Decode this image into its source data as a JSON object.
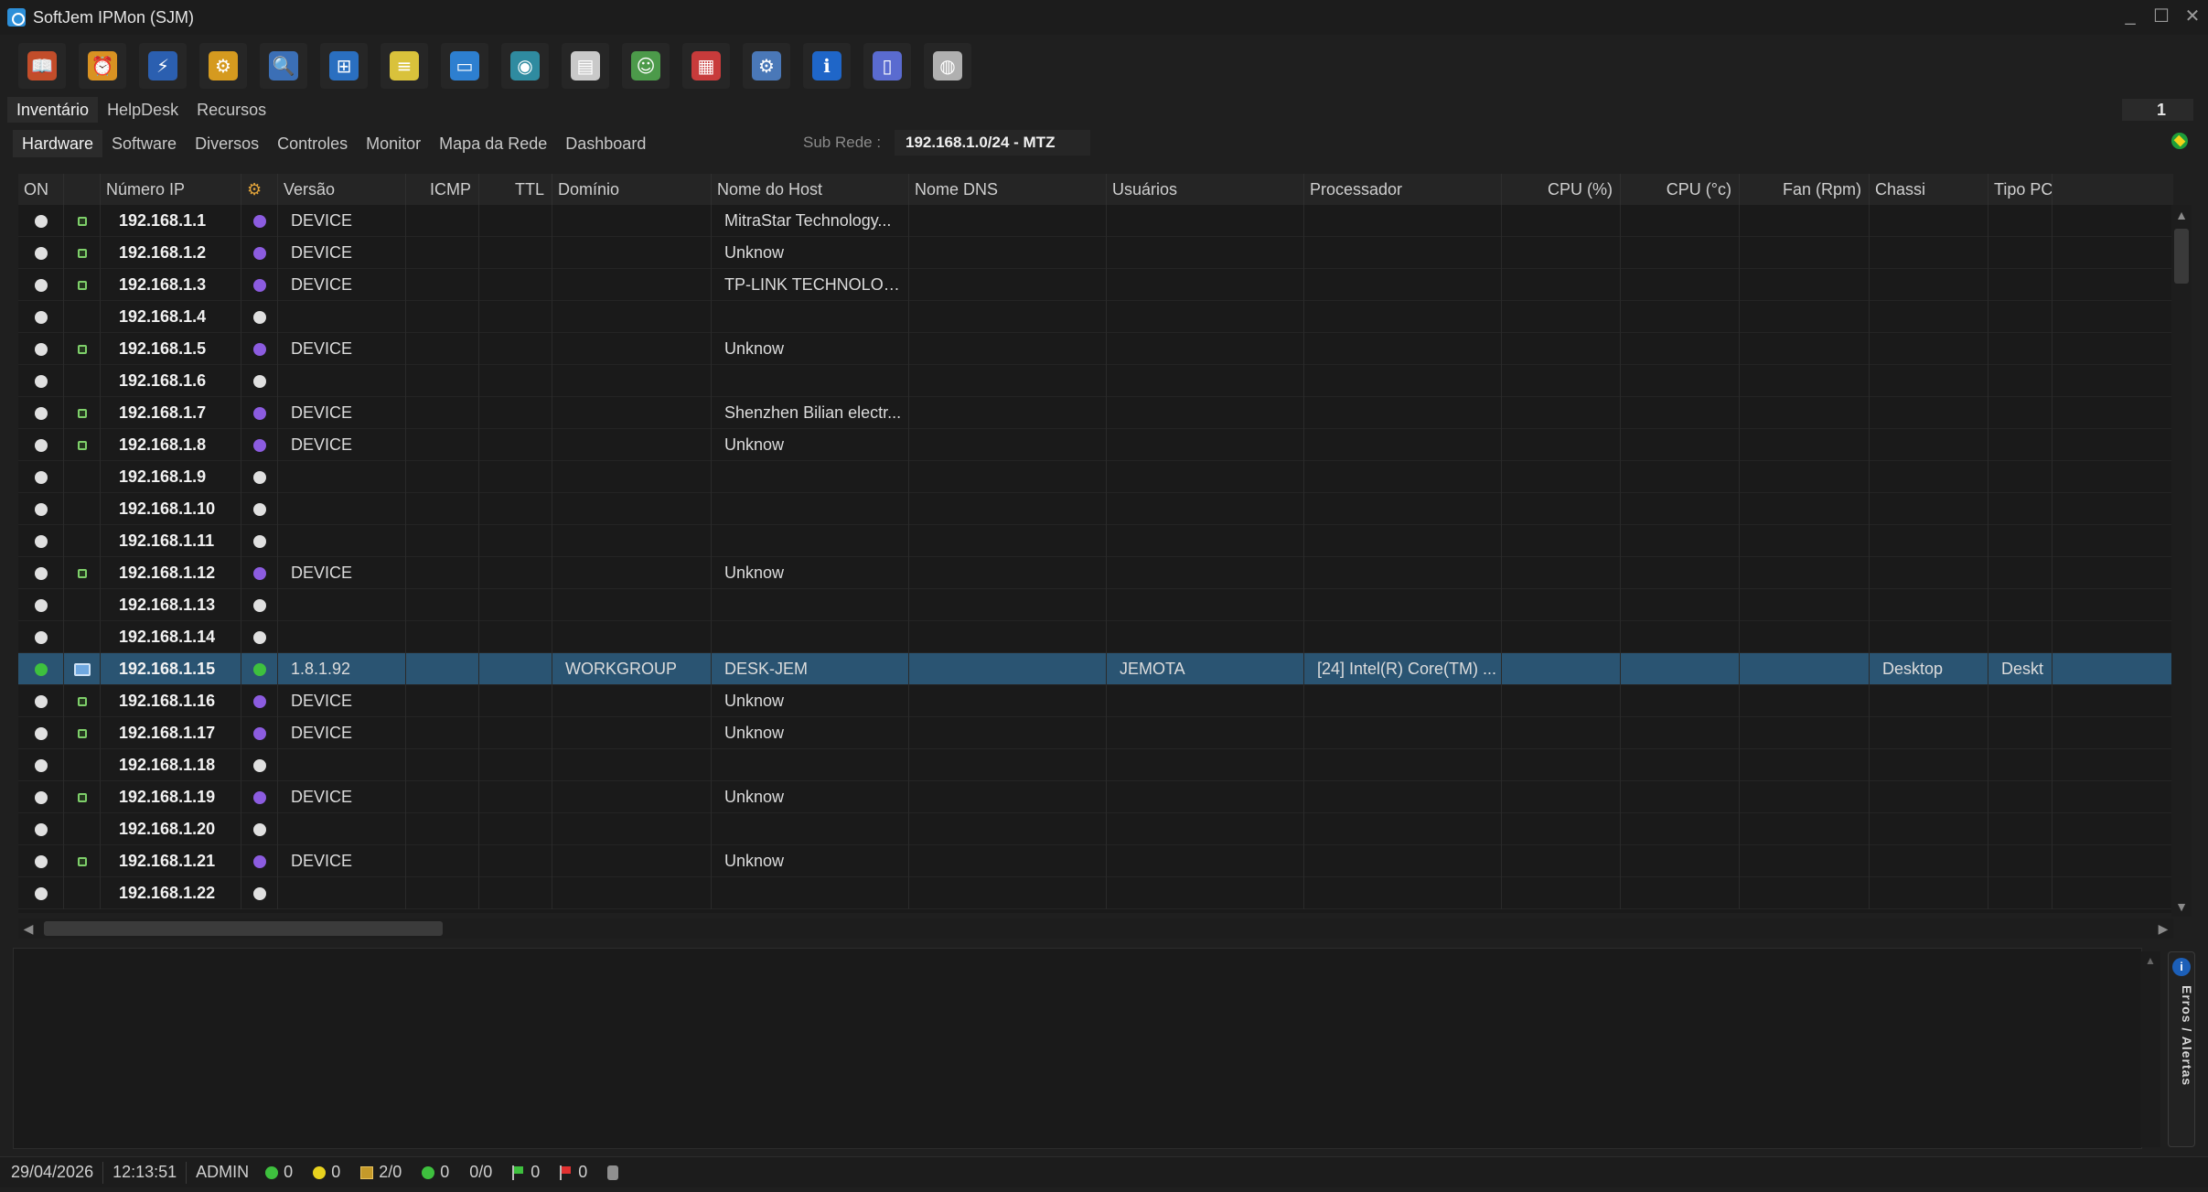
{
  "window": {
    "title": "SoftJem IPMon (SJM)",
    "controls": [
      "_",
      "☐",
      "✕"
    ]
  },
  "toolbar": {
    "buttons": [
      {
        "name": "open-book-icon",
        "color": "#c24d2a",
        "glyph": "📖"
      },
      {
        "name": "calendar-clock-icon",
        "color": "#d99222",
        "glyph": "⏰"
      },
      {
        "name": "lightning-icon",
        "color": "#2b5fb0",
        "glyph": "⚡"
      },
      {
        "name": "gears-icon",
        "color": "#d59a1f",
        "glyph": "⚙"
      },
      {
        "name": "magnifier-icon",
        "color": "#3b6fb6",
        "glyph": "🔍"
      },
      {
        "name": "network-add-icon",
        "color": "#2a6fc0",
        "glyph": "⊞"
      },
      {
        "name": "document-icon",
        "color": "#d9c23b",
        "glyph": "≡"
      },
      {
        "name": "monitor-icon",
        "color": "#2d7fd0",
        "glyph": "▭"
      },
      {
        "name": "camera-icon",
        "color": "#2f8ba0",
        "glyph": "◉"
      },
      {
        "name": "clipboard-icon",
        "color": "#c9c9c9",
        "glyph": "▤"
      },
      {
        "name": "users-icon",
        "color": "#4c9a4a",
        "glyph": "☺"
      },
      {
        "name": "chart-tools-icon",
        "color": "#c83b3b",
        "glyph": "▦"
      },
      {
        "name": "settings-icon",
        "color": "#4a78b8",
        "glyph": "⚙"
      },
      {
        "name": "info-icon",
        "color": "#1f66c8",
        "glyph": "ℹ"
      },
      {
        "name": "door-exit-icon",
        "color": "#5a6bd0",
        "glyph": "▯"
      },
      {
        "name": "palette-icon",
        "color": "#b0b0b0",
        "glyph": "◍"
      }
    ]
  },
  "top_tabs": [
    "Inventário",
    "HelpDesk",
    "Recursos"
  ],
  "page_number": "1",
  "sub_tabs": [
    "Hardware",
    "Software",
    "Diversos",
    "Controles",
    "Monitor",
    "Mapa da Rede",
    "Dashboard"
  ],
  "subnet": {
    "label": "Sub Rede :",
    "value": "192.168.1.0/24 - MTZ"
  },
  "columns": [
    "ON",
    "",
    "Número IP",
    "",
    "Versão",
    "ICMP",
    "TTL",
    "Domínio",
    "Nome do Host",
    "Nome DNS",
    "Usuários",
    "Processador",
    "CPU (%)",
    "CPU (°c)",
    "Fan (Rpm)",
    "Chassi",
    "Tipo PC"
  ],
  "rows": [
    {
      "type": "device",
      "ip": "192.168.1.1",
      "status": "purple",
      "versao": "DEVICE",
      "dominio": "",
      "host": "MitraStar Technology...",
      "usuarios": "",
      "processador": "",
      "chassi": "",
      "tipo": ""
    },
    {
      "type": "device",
      "ip": "192.168.1.2",
      "status": "purple",
      "versao": "DEVICE",
      "dominio": "",
      "host": "Unknow",
      "usuarios": "",
      "processador": "",
      "chassi": "",
      "tipo": ""
    },
    {
      "type": "device",
      "ip": "192.168.1.3",
      "status": "purple",
      "versao": "DEVICE",
      "dominio": "",
      "host": "TP-LINK TECHNOLOG...",
      "usuarios": "",
      "processador": "",
      "chassi": "",
      "tipo": ""
    },
    {
      "type": "none",
      "ip": "192.168.1.4",
      "status": "white",
      "versao": "",
      "dominio": "",
      "host": "",
      "usuarios": "",
      "processador": "",
      "chassi": "",
      "tipo": ""
    },
    {
      "type": "device",
      "ip": "192.168.1.5",
      "status": "purple",
      "versao": "DEVICE",
      "dominio": "",
      "host": "Unknow",
      "usuarios": "",
      "processador": "",
      "chassi": "",
      "tipo": ""
    },
    {
      "type": "none",
      "ip": "192.168.1.6",
      "status": "white",
      "versao": "",
      "dominio": "",
      "host": "",
      "usuarios": "",
      "processador": "",
      "chassi": "",
      "tipo": ""
    },
    {
      "type": "device",
      "ip": "192.168.1.7",
      "status": "purple",
      "versao": "DEVICE",
      "dominio": "",
      "host": "Shenzhen Bilian electr...",
      "usuarios": "",
      "processador": "",
      "chassi": "",
      "tipo": ""
    },
    {
      "type": "device",
      "ip": "192.168.1.8",
      "status": "purple",
      "versao": "DEVICE",
      "dominio": "",
      "host": "Unknow",
      "usuarios": "",
      "processador": "",
      "chassi": "",
      "tipo": ""
    },
    {
      "type": "none",
      "ip": "192.168.1.9",
      "status": "white",
      "versao": "",
      "dominio": "",
      "host": "",
      "usuarios": "",
      "processador": "",
      "chassi": "",
      "tipo": ""
    },
    {
      "type": "none",
      "ip": "192.168.1.10",
      "status": "white",
      "versao": "",
      "dominio": "",
      "host": "",
      "usuarios": "",
      "processador": "",
      "chassi": "",
      "tipo": ""
    },
    {
      "type": "none",
      "ip": "192.168.1.11",
      "status": "white",
      "versao": "",
      "dominio": "",
      "host": "",
      "usuarios": "",
      "processador": "",
      "chassi": "",
      "tipo": ""
    },
    {
      "type": "device",
      "ip": "192.168.1.12",
      "status": "purple",
      "versao": "DEVICE",
      "dominio": "",
      "host": "Unknow",
      "usuarios": "",
      "processador": "",
      "chassi": "",
      "tipo": ""
    },
    {
      "type": "none",
      "ip": "192.168.1.13",
      "status": "white",
      "versao": "",
      "dominio": "",
      "host": "",
      "usuarios": "",
      "processador": "",
      "chassi": "",
      "tipo": ""
    },
    {
      "type": "none",
      "ip": "192.168.1.14",
      "status": "white",
      "versao": "",
      "dominio": "",
      "host": "",
      "usuarios": "",
      "processador": "",
      "chassi": "",
      "tipo": ""
    },
    {
      "type": "pc",
      "ip": "192.168.1.15",
      "status": "green",
      "versao": "1.8.1.92",
      "dominio": "WORKGROUP",
      "host": "DESK-JEM",
      "usuarios": "JEMOTA",
      "processador": "[24] Intel(R) Core(TM) ...",
      "chassi": "Desktop",
      "tipo": "Deskt",
      "selected": true
    },
    {
      "type": "device",
      "ip": "192.168.1.16",
      "status": "purple",
      "versao": "DEVICE",
      "dominio": "",
      "host": "Unknow",
      "usuarios": "",
      "processador": "",
      "chassi": "",
      "tipo": ""
    },
    {
      "type": "device",
      "ip": "192.168.1.17",
      "status": "purple",
      "versao": "DEVICE",
      "dominio": "",
      "host": "Unknow",
      "usuarios": "",
      "processador": "",
      "chassi": "",
      "tipo": ""
    },
    {
      "type": "none",
      "ip": "192.168.1.18",
      "status": "white",
      "versao": "",
      "dominio": "",
      "host": "",
      "usuarios": "",
      "processador": "",
      "chassi": "",
      "tipo": ""
    },
    {
      "type": "device",
      "ip": "192.168.1.19",
      "status": "purple",
      "versao": "DEVICE",
      "dominio": "",
      "host": "Unknow",
      "usuarios": "",
      "processador": "",
      "chassi": "",
      "tipo": ""
    },
    {
      "type": "none",
      "ip": "192.168.1.20",
      "status": "white",
      "versao": "",
      "dominio": "",
      "host": "",
      "usuarios": "",
      "processador": "",
      "chassi": "",
      "tipo": ""
    },
    {
      "type": "device",
      "ip": "192.168.1.21",
      "status": "purple",
      "versao": "DEVICE",
      "dominio": "",
      "host": "Unknow",
      "usuarios": "",
      "processador": "",
      "chassi": "",
      "tipo": ""
    },
    {
      "type": "none",
      "ip": "192.168.1.22",
      "status": "white",
      "versao": "",
      "dominio": "",
      "host": "",
      "usuarios": "",
      "processador": "",
      "chassi": "",
      "tipo": ""
    }
  ],
  "side_panel": {
    "label": "Erros / Alertas"
  },
  "status_bar": {
    "date": "29/04/2026",
    "time": "12:13:51",
    "user": "ADMIN",
    "green_count": "0",
    "yellow_count": "0",
    "inventory": "2/0",
    "green_count_2": "0",
    "ratio": "0/0",
    "green_flag_count": "0",
    "red_flag_count": "0"
  },
  "colors": {
    "background": "#1f1f1f",
    "selected_row": "#2a5472",
    "online_green": "#3ec03e",
    "device_purple": "#8c5ce0"
  }
}
